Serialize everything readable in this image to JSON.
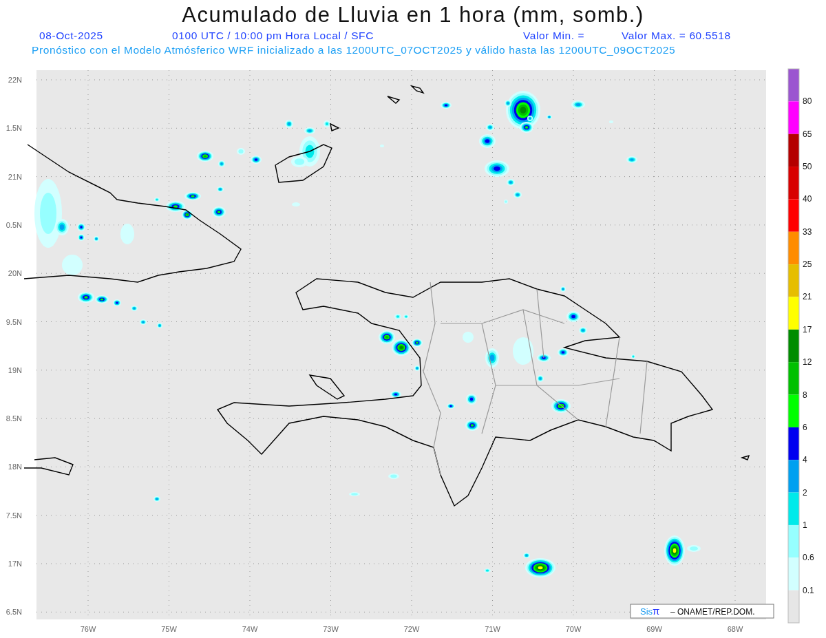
{
  "title": "Acumulado de Lluvia en 1 hora (mm, somb.)",
  "info_line": {
    "date": "08-Oct-2025",
    "time": "0100 UTC / 10:00 pm Hora Local / SFC",
    "min": "Valor Min. =",
    "max": "Valor Max. = 60.5518"
  },
  "forecast_line": "Pronóstico con el Modelo Atmósferico WRF inicializado a las 1200UTC_07OCT2025 y válido hasta las  1200UTC_09OCT2025",
  "lat_labels": [
    "22N",
    "1.5N",
    "21N",
    "0.5N",
    "20N",
    "9.5N",
    "19N",
    "8.5N",
    "18N",
    "7.5N",
    "17N",
    "6.5N"
  ],
  "lon_labels": [
    "76W",
    "75W",
    "74W",
    "73W",
    "72W",
    "71W",
    "70W",
    "69W",
    "68W"
  ],
  "legend": [
    {
      "color": "#9b55d0",
      "label": "80"
    },
    {
      "color": "#ff00ff",
      "label": "65"
    },
    {
      "color": "#b40000",
      "label": "50"
    },
    {
      "color": "#d80000",
      "label": "40"
    },
    {
      "color": "#ff0000",
      "label": "33"
    },
    {
      "color": "#ff8c00",
      "label": "25"
    },
    {
      "color": "#e6be00",
      "label": "21"
    },
    {
      "color": "#ffff00",
      "label": "17"
    },
    {
      "color": "#008c00",
      "label": "12"
    },
    {
      "color": "#00c000",
      "label": "8"
    },
    {
      "color": "#00ff00",
      "label": "6"
    },
    {
      "color": "#0000f0",
      "label": "4"
    },
    {
      "color": "#00a0f0",
      "label": "2"
    },
    {
      "color": "#00eaea",
      "label": "1"
    },
    {
      "color": "#96ffff",
      "label": "0.6"
    },
    {
      "color": "#d2ffff",
      "label": "0.1"
    },
    {
      "color": "#e6e6e6"
    }
  ],
  "credit": {
    "logo_a": "Sis",
    "logo_b": "π",
    "text": "– ONAMET/REP.DOM."
  }
}
